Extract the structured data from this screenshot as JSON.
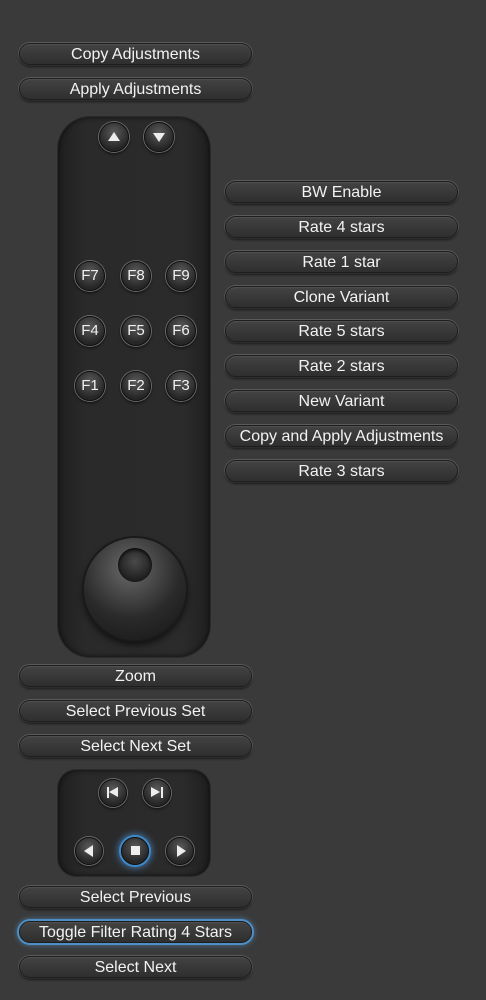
{
  "top_buttons": {
    "copy_adjustments": "Copy Adjustments",
    "apply_adjustments": "Apply Adjustments"
  },
  "function_keys": {
    "row1": [
      "F7",
      "F8",
      "F9"
    ],
    "row2": [
      "F4",
      "F5",
      "F6"
    ],
    "row3": [
      "F1",
      "F2",
      "F3"
    ]
  },
  "right_buttons": [
    "BW Enable",
    "Rate 4 stars",
    "Rate 1 star",
    "Clone Variant",
    "Rate 5 stars",
    "Rate 2 stars",
    "New Variant",
    "Copy and Apply Adjustments",
    "Rate 3 stars"
  ],
  "middle_buttons": {
    "zoom": "Zoom",
    "select_previous_set": "Select Previous Set",
    "select_next_set": "Select Next Set"
  },
  "bottom_buttons": {
    "select_previous": "Select Previous",
    "toggle_filter": "Toggle Filter Rating 4 Stars",
    "select_next": "Select Next"
  },
  "icons": {
    "up": "arrow-up-icon",
    "down": "arrow-down-icon",
    "skip_back": "skip-back-icon",
    "skip_forward": "skip-forward-icon",
    "left": "arrow-left-icon",
    "stop": "stop-icon",
    "right": "arrow-right-icon"
  },
  "colors": {
    "background": "#3a3a3a",
    "highlight": "#4f8ec4"
  }
}
